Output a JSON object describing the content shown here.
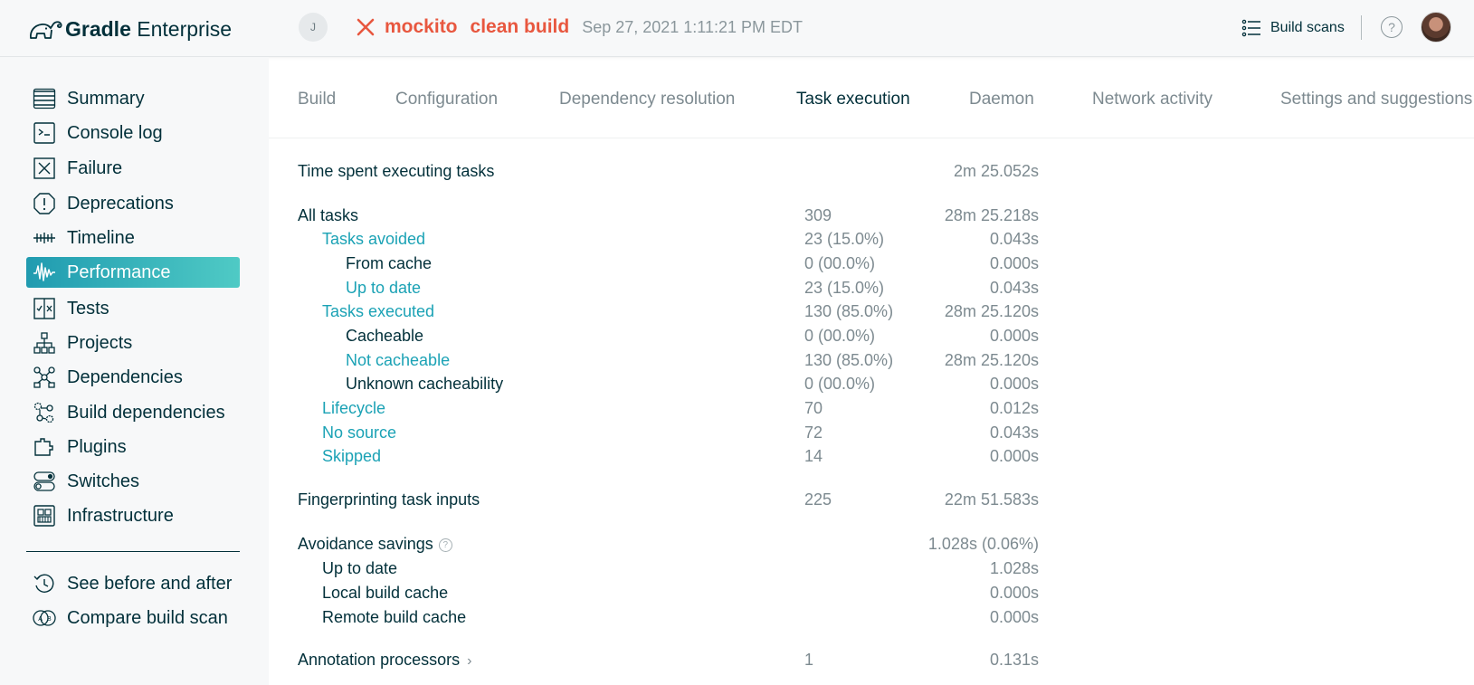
{
  "header": {
    "brand_bold": "Gradle",
    "brand_light": "Enterprise",
    "user_initial": "J",
    "project": "mockito",
    "tasks": "clean build",
    "date": "Sep 27, 2021 1:11:21 PM EDT",
    "build_scans_label": "Build scans",
    "help_label": "?",
    "status_color": "#e8573f"
  },
  "sidebar": {
    "items": [
      {
        "label": "Summary",
        "icon": "summary-icon"
      },
      {
        "label": "Console log",
        "icon": "console-icon"
      },
      {
        "label": "Failure",
        "icon": "failure-icon"
      },
      {
        "label": "Deprecations",
        "icon": "deprecations-icon"
      },
      {
        "label": "Timeline",
        "icon": "timeline-icon"
      },
      {
        "label": "Performance",
        "icon": "performance-icon",
        "active": true
      },
      {
        "label": "Tests",
        "icon": "tests-icon"
      },
      {
        "label": "Projects",
        "icon": "projects-icon"
      },
      {
        "label": "Dependencies",
        "icon": "dependencies-icon"
      },
      {
        "label": "Build dependencies",
        "icon": "build-dependencies-icon"
      },
      {
        "label": "Plugins",
        "icon": "plugins-icon"
      },
      {
        "label": "Switches",
        "icon": "switches-icon"
      },
      {
        "label": "Infrastructure",
        "icon": "infrastructure-icon"
      }
    ],
    "secondary": [
      {
        "label": "See before and after",
        "icon": "history-icon"
      },
      {
        "label": "Compare build scan",
        "icon": "compare-icon"
      }
    ],
    "active_color": "#209bb0"
  },
  "tabs": [
    {
      "label": "Build"
    },
    {
      "label": "Configuration"
    },
    {
      "label": "Dependency resolution"
    },
    {
      "label": "Task execution",
      "active": true
    },
    {
      "label": "Daemon"
    },
    {
      "label": "Network activity"
    },
    {
      "label": "Settings and suggestions"
    }
  ],
  "metrics": {
    "time_spent": {
      "label": "Time spent executing tasks",
      "time": "2m 25.052s"
    },
    "all_tasks": {
      "label": "All tasks",
      "count": "309",
      "time": "28m 25.218s"
    },
    "tasks_avoided": {
      "label": "Tasks avoided",
      "count": "23 (15.0%)",
      "time": "0.043s"
    },
    "from_cache": {
      "label": "From cache",
      "count": "0 (00.0%)",
      "time": "0.000s"
    },
    "up_to_date": {
      "label": "Up to date",
      "count": "23 (15.0%)",
      "time": "0.043s"
    },
    "tasks_executed": {
      "label": "Tasks executed",
      "count": "130 (85.0%)",
      "time": "28m 25.120s"
    },
    "cacheable": {
      "label": "Cacheable",
      "count": "0 (00.0%)",
      "time": "0.000s"
    },
    "not_cacheable": {
      "label": "Not cacheable",
      "count": "130 (85.0%)",
      "time": "28m 25.120s"
    },
    "unknown_cacheability": {
      "label": "Unknown cacheability",
      "count": "0 (00.0%)",
      "time": "0.000s"
    },
    "lifecycle": {
      "label": "Lifecycle",
      "count": "70",
      "time": "0.012s"
    },
    "no_source": {
      "label": "No source",
      "count": "72",
      "time": "0.043s"
    },
    "skipped": {
      "label": "Skipped",
      "count": "14",
      "time": "0.000s"
    },
    "fingerprinting": {
      "label": "Fingerprinting task inputs",
      "count": "225",
      "time": "22m 51.583s"
    },
    "avoidance_savings": {
      "label": "Avoidance savings",
      "time": "1.028s (0.06%)"
    },
    "savings_up_to_date": {
      "label": "Up to date",
      "time": "1.028s"
    },
    "local_build_cache": {
      "label": "Local build cache",
      "time": "0.000s"
    },
    "remote_build_cache": {
      "label": "Remote build cache",
      "time": "0.000s"
    },
    "annotation_processors": {
      "label": "Annotation processors",
      "count": "1",
      "time": "0.131s"
    }
  },
  "link_color": "#1ba2b5"
}
